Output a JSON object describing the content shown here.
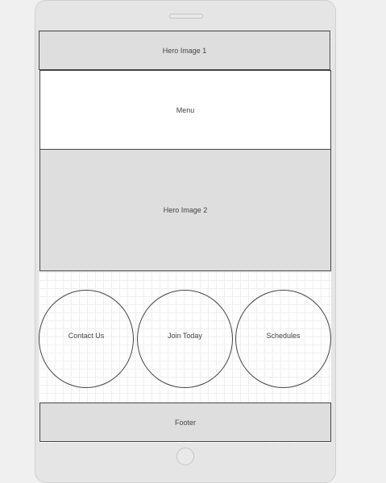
{
  "hero1": {
    "label": "Hero Image 1"
  },
  "menu": {
    "label": "Menu"
  },
  "hero2": {
    "label": "Hero Image 2"
  },
  "actions": {
    "contact": "Contact Us",
    "join": "Join Today",
    "schedules": "Schedules"
  },
  "footer": {
    "label": "Footer"
  },
  "colors": {
    "placeholder_fill": "#dedede",
    "stroke": "#444444",
    "device": "#e5e5e5"
  }
}
